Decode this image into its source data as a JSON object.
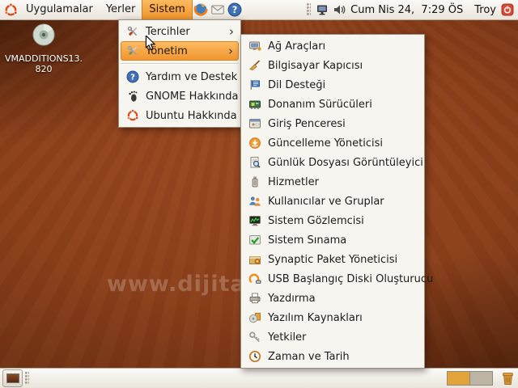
{
  "top_panel": {
    "menu_items": [
      {
        "label": "Uygulamalar",
        "active": false
      },
      {
        "label": "Yerler",
        "active": false
      },
      {
        "label": "Sistem",
        "active": true
      }
    ],
    "launcher_icons": [
      {
        "name": "firefox-browser"
      },
      {
        "name": "mail-client"
      },
      {
        "name": "help-browser"
      }
    ],
    "tray_icons": [
      {
        "name": "network-monitor"
      },
      {
        "name": "volume"
      }
    ],
    "clock": "Cum Nis 24,  7:29 ÖS",
    "user_name": "Troy",
    "power_button": "logout-power"
  },
  "desktop": {
    "cd_label_line1": "VMADDITIONS13.",
    "cd_label_line2": "820",
    "watermark": "www.dijita"
  },
  "system_menu": {
    "items": [
      {
        "label": "Tercihler",
        "icon": "preferences-tools",
        "has_submenu": true,
        "highlighted": false
      },
      {
        "label": "Yönetim",
        "icon": "administration-tools",
        "has_submenu": true,
        "highlighted": true
      },
      {
        "label": "Yardım ve Destek",
        "icon": "help-question",
        "has_submenu": false,
        "highlighted": false
      },
      {
        "label": "GNOME Hakkında",
        "icon": "gnome-foot",
        "has_submenu": false,
        "highlighted": false
      },
      {
        "label": "Ubuntu Hakkında",
        "icon": "ubuntu-logo",
        "has_submenu": false,
        "highlighted": false
      }
    ]
  },
  "admin_submenu": {
    "items": [
      {
        "label": "Ağ Araçları",
        "icon": "network-tools"
      },
      {
        "label": "Bilgisayar Kapıcısı",
        "icon": "computer-janitor-broom"
      },
      {
        "label": "Dil Desteği",
        "icon": "language-flag"
      },
      {
        "label": "Donanım Sürücüleri",
        "icon": "hardware-drivers"
      },
      {
        "label": "Giriş Penceresi",
        "icon": "login-window"
      },
      {
        "label": "Güncelleme Yöneticisi",
        "icon": "update-manager"
      },
      {
        "label": "Günlük Dosyası Görüntüleyici",
        "icon": "log-viewer"
      },
      {
        "label": "Hizmetler",
        "icon": "services"
      },
      {
        "label": "Kullanıcılar ve Gruplar",
        "icon": "users-groups"
      },
      {
        "label": "Sistem Gözlemcisi",
        "icon": "system-monitor"
      },
      {
        "label": "Sistem Sınama",
        "icon": "system-testing"
      },
      {
        "label": "Synaptic Paket Yöneticisi",
        "icon": "synaptic-package-manager"
      },
      {
        "label": "USB Başlangıç Diski Oluşturucu",
        "icon": "usb-creator"
      },
      {
        "label": "Yazdırma",
        "icon": "printing"
      },
      {
        "label": "Yazılım Kaynakları",
        "icon": "software-sources"
      },
      {
        "label": "Yetkiler",
        "icon": "authorizations-keys"
      },
      {
        "label": "Zaman ve Tarih",
        "icon": "time-date-clock"
      }
    ]
  },
  "bottom_panel": {
    "show_desktop_button": "show-desktop",
    "workspaces": [
      {
        "active": true
      },
      {
        "active": false
      }
    ],
    "trash": "trash"
  },
  "glyphs": {
    "question_mark": "?",
    "submenu_arrow": "›"
  },
  "colors": {
    "selection_orange": "#F0932D",
    "panel_bg": "#EFEAE1",
    "menu_bg": "#F7F5EF",
    "wallpaper_brown": "#8A3F1A",
    "ubuntu_red": "#DD4814"
  }
}
